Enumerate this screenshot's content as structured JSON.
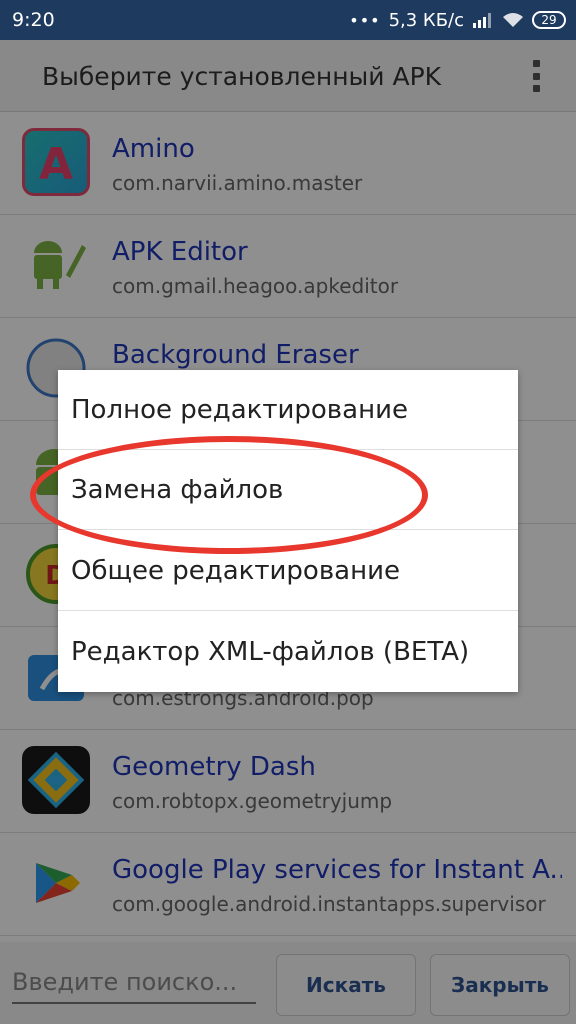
{
  "status_bar": {
    "time": "9:20",
    "dots": "•••",
    "speed": "5,3 КБ/с",
    "battery": "29"
  },
  "title_bar": {
    "title": "Выберите установленный APK"
  },
  "apps": [
    {
      "name": "Amino",
      "package": "com.narvii.amino.master",
      "icon": "amino-icon"
    },
    {
      "name": "APK Editor",
      "package": "com.gmail.heagoo.apkeditor",
      "icon": "apk-editor-icon"
    },
    {
      "name": "Background Eraser",
      "package": "",
      "icon": "background-eraser-icon"
    },
    {
      "name": "",
      "package": "",
      "icon": "android-app-icon"
    },
    {
      "name": "",
      "package": "",
      "icon": "ld-app-icon"
    },
    {
      "name": "",
      "package": "com.estrongs.android.pop",
      "icon": "es-file-explorer-icon"
    },
    {
      "name": "Geometry Dash",
      "package": "com.robtopx.geometryjump",
      "icon": "geometry-dash-icon"
    },
    {
      "name": "Google Play services for Instant A...",
      "package": "com.google.android.instantapps.supervisor",
      "icon": "google-play-services-icon"
    }
  ],
  "bottom_bar": {
    "search_placeholder": "Введите поиско...",
    "search_button": "Искать",
    "close_button": "Закрыть"
  },
  "popup": {
    "options": [
      "Полное редактирование",
      "Замена файлов",
      "Общее редактирование",
      "Редактор XML-файлов (BETA)"
    ],
    "highlight_color": "#e8372d"
  }
}
